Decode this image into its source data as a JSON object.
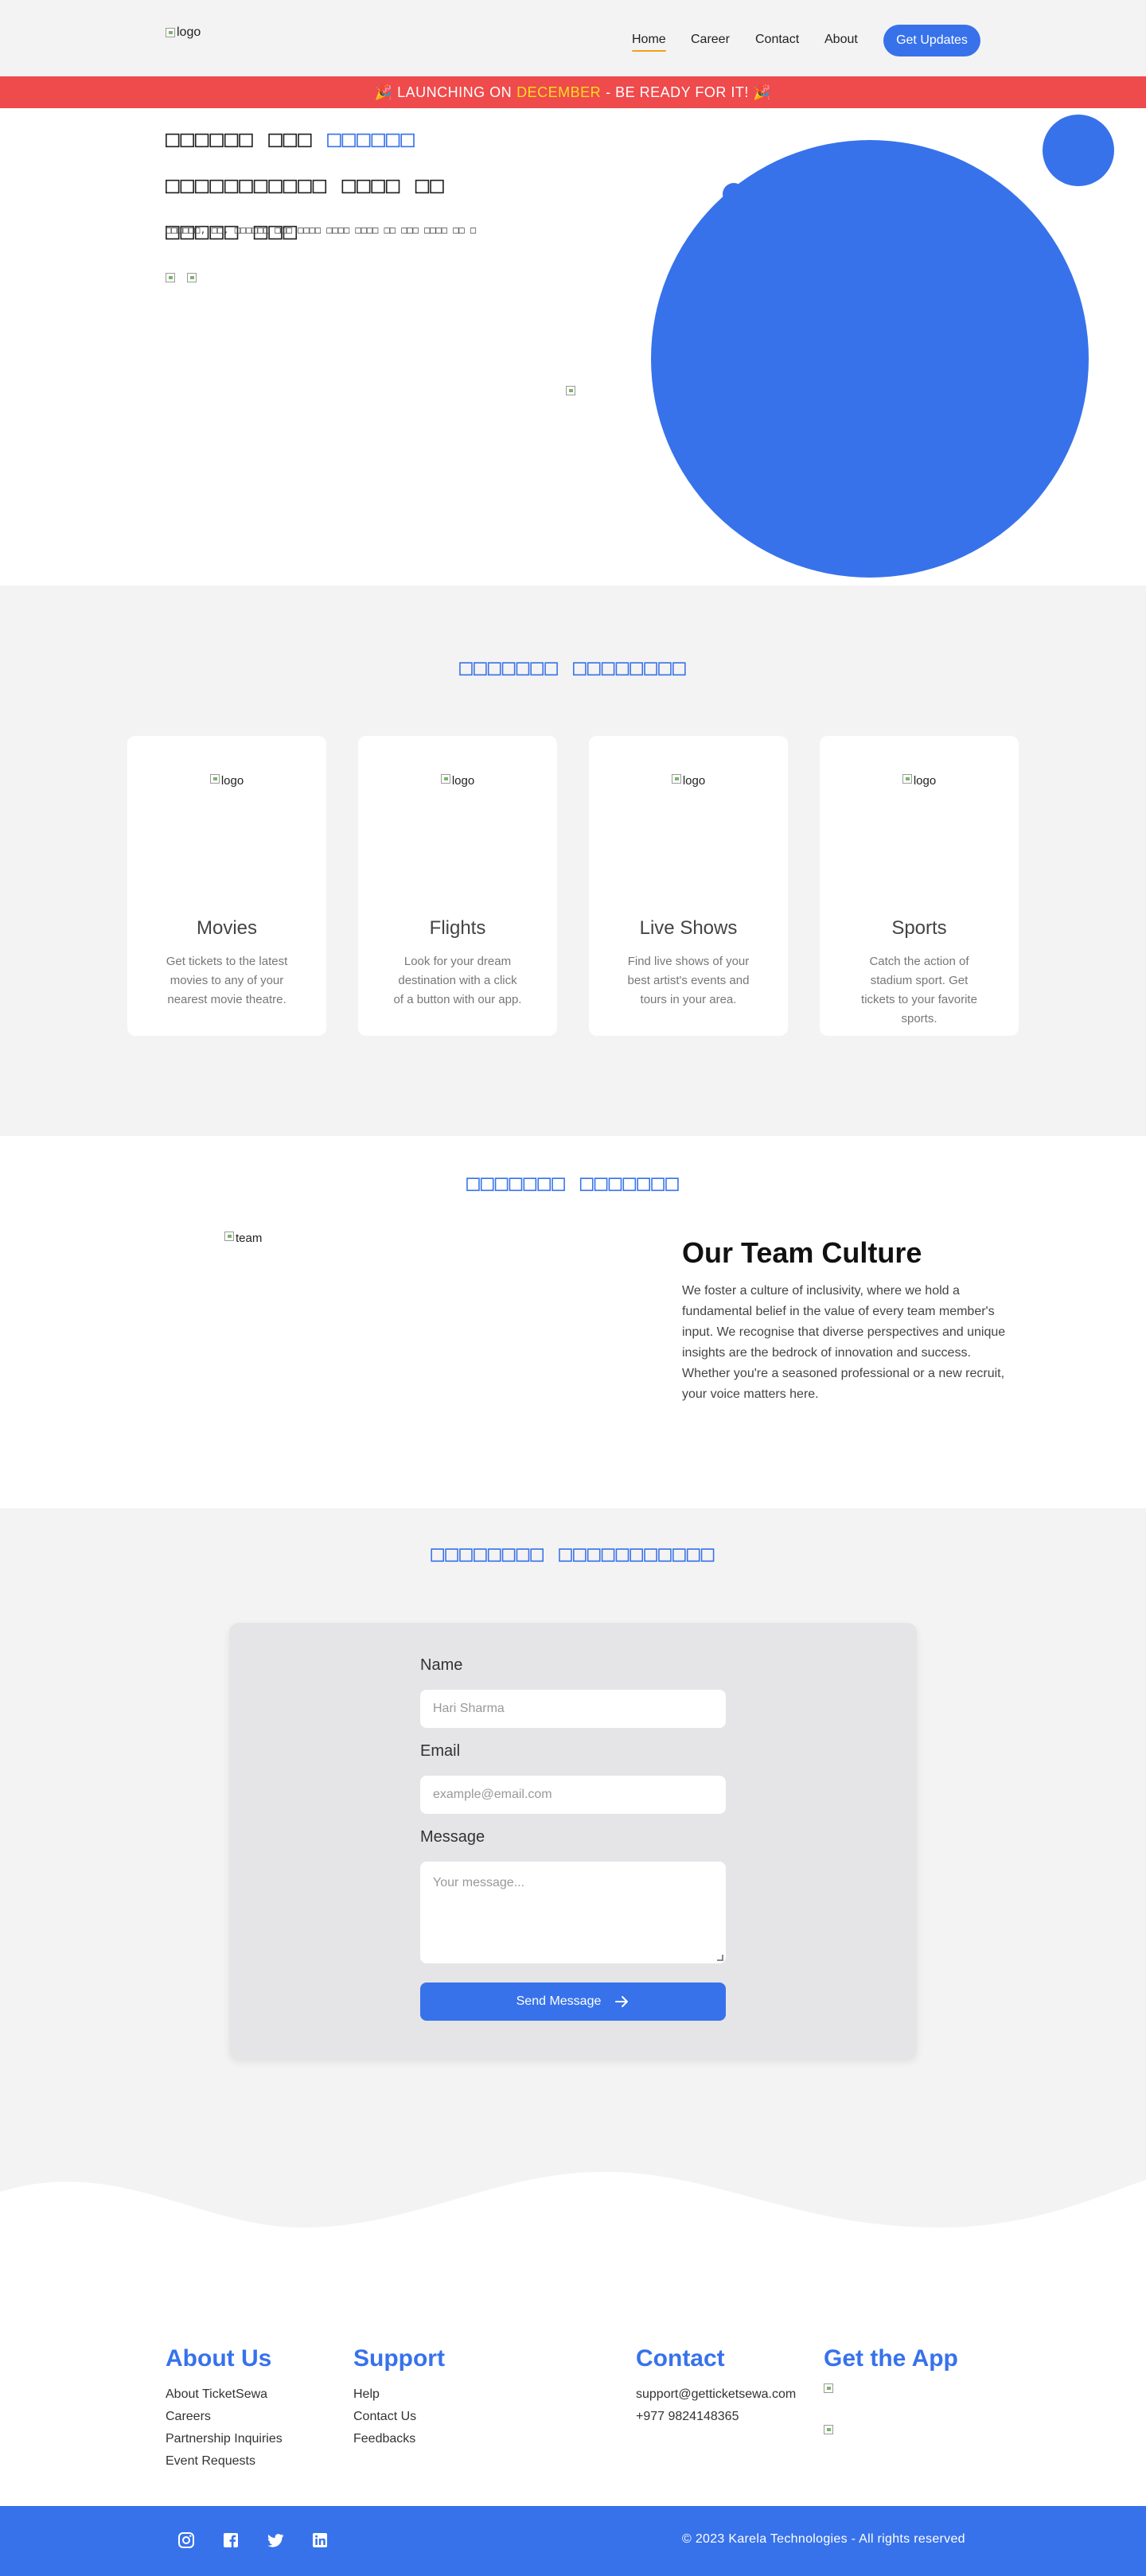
{
  "nav": {
    "logo_alt": "logo",
    "links": [
      "Home",
      "Career",
      "Contact",
      "About"
    ],
    "cta": "Get Updates"
  },
  "banner": {
    "emoji_left": "🎉",
    "before": "LAUNCHING ON",
    "highlight": "DECEMBER",
    "after": "- BE READY FOR IT!",
    "emoji_right": "🎉"
  },
  "hero": {
    "title_part1": "□□□□□□ □□□ ",
    "title_blue": "□□□□□□",
    "title_part2": " □□□□□□□□□□□ □□□□ □□ □□□□□ □□□",
    "subtitle": "□□□□□□, □□, □□□□□□ □□□ □□□□ □□□□ □□□□ □□ □□□ □□□□ □□ □"
  },
  "services": {
    "title": "□□□□□□□ □□□□□□□□",
    "logo_alt": "logo",
    "cards": [
      {
        "title": "Movies",
        "desc": "Get tickets to the latest movies to any of your nearest movie theatre."
      },
      {
        "title": "Flights",
        "desc": "Look for your dream destination with a click of a button with our app."
      },
      {
        "title": "Live Shows",
        "desc": "Find live shows of your best artist's events and tours in your area."
      },
      {
        "title": "Sports",
        "desc": "Catch the action of stadium sport. Get tickets to your favorite sports."
      }
    ]
  },
  "team": {
    "section_title": "□□□□□□□ □□□□□□□",
    "img_alt": "team",
    "heading": "Our Team Culture",
    "body": "We foster a culture of inclusivity, where we hold a fundamental belief in the value of every team member's input. We recognise that diverse perspectives and unique insights are the bedrock of innovation and success. Whether you're a seasoned professional or a new recruit, your voice matters here."
  },
  "contact": {
    "section_title": "□□□□□□□□ □□□□□□□□□□□",
    "name_label": "Name",
    "name_placeholder": "Hari Sharma",
    "email_label": "Email",
    "email_placeholder": "example@email.com",
    "message_label": "Message",
    "message_placeholder": "Your message...",
    "submit": "Send Message"
  },
  "footer": {
    "about": {
      "title": "About Us",
      "links": [
        "About TicketSewa",
        "Careers",
        "Partnership Inquiries",
        "Event Requests"
      ]
    },
    "support": {
      "title": "Support",
      "links": [
        "Help",
        "Contact Us",
        "Feedbacks"
      ]
    },
    "contact": {
      "title": "Contact",
      "links": [
        "support@getticketsewa.com",
        "+977 9824148365"
      ]
    },
    "app": {
      "title": "Get the App"
    },
    "copyright": "© 2023 Karela Technologies - All rights reserved",
    "social_icons": [
      "instagram-icon",
      "facebook-icon",
      "twitter-icon",
      "linkedin-icon"
    ]
  },
  "colors": {
    "accent": "#3772eb",
    "banner": "#ef4a4c",
    "banner_highlight": "#f8df1c",
    "nav_underline": "#f0a21b",
    "background": "#f4f3f3"
  }
}
